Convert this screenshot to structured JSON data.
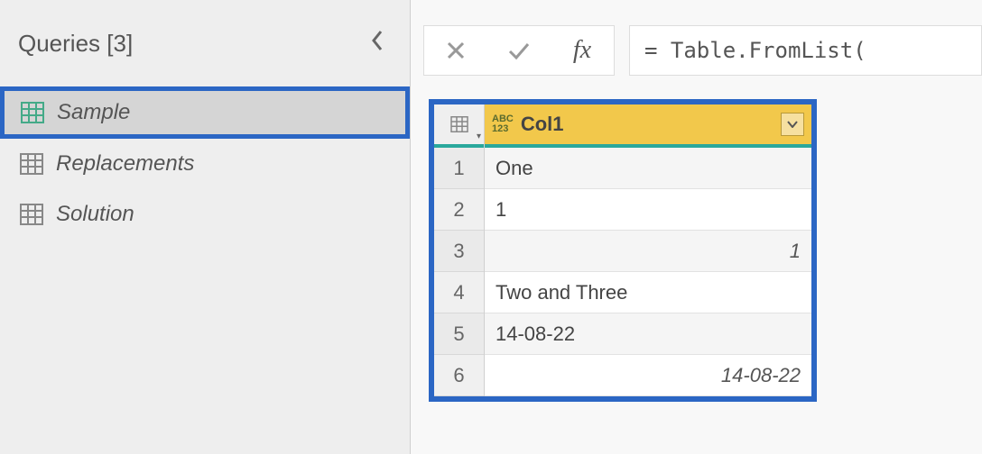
{
  "queries": {
    "header": "Queries [3]",
    "items": [
      {
        "label": "Sample",
        "selected": true
      },
      {
        "label": "Replacements",
        "selected": false
      },
      {
        "label": "Solution",
        "selected": false
      }
    ]
  },
  "formula": {
    "text": "= Table.FromList("
  },
  "table": {
    "column": {
      "name": "Col1",
      "type_label_top": "ABC",
      "type_label_bottom": "123"
    },
    "rows": [
      {
        "n": "1",
        "value": "One",
        "align": "left"
      },
      {
        "n": "2",
        "value": "1",
        "align": "left"
      },
      {
        "n": "3",
        "value": "1",
        "align": "right"
      },
      {
        "n": "4",
        "value": "Two and Three",
        "align": "left"
      },
      {
        "n": "5",
        "value": "14-08-22",
        "align": "left"
      },
      {
        "n": "6",
        "value": "14-08-22",
        "align": "right"
      }
    ]
  }
}
